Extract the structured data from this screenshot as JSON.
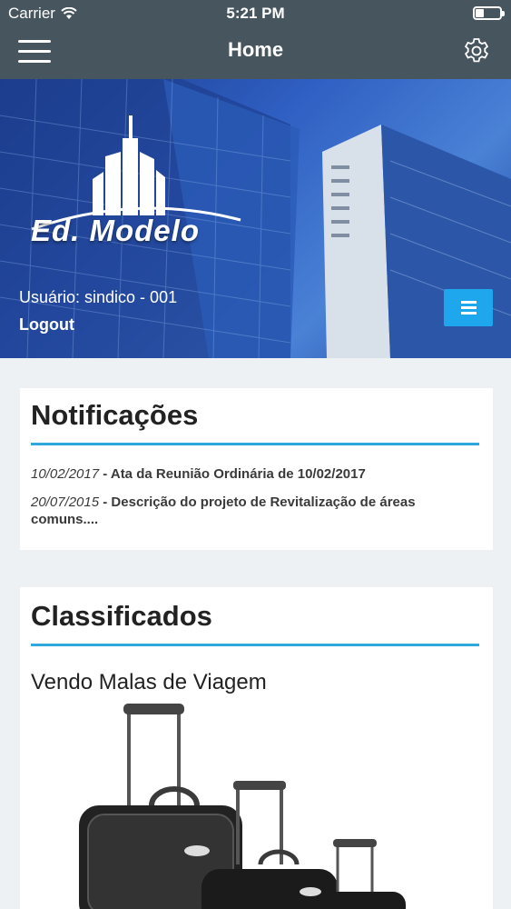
{
  "status_bar": {
    "carrier": "Carrier",
    "time": "5:21 PM"
  },
  "nav": {
    "title": "Home"
  },
  "hero": {
    "logo_text": "Ed. Modelo",
    "user_label": "Usuário: sindico - 001",
    "logout_label": "Logout"
  },
  "notifications": {
    "title": "Notificações",
    "items": [
      {
        "date": "10/02/2017",
        "separator": " - ",
        "text": "Ata da Reunião Ordinária de 10/02/2017"
      },
      {
        "date": "20/07/2015",
        "separator": " - ",
        "text": "Descrição do projeto de Revitalização de áreas comuns...."
      }
    ]
  },
  "classifieds": {
    "title": "Classificados",
    "items": [
      {
        "title": "Vendo Malas de Viagem"
      }
    ]
  },
  "colors": {
    "bar": "#47555e",
    "accent": "#2fa8de",
    "button": "#1ea7ec"
  },
  "icons": {
    "menu": "hamburger-icon",
    "settings": "gear-icon",
    "wifi": "wifi-icon",
    "battery": "battery-icon"
  }
}
